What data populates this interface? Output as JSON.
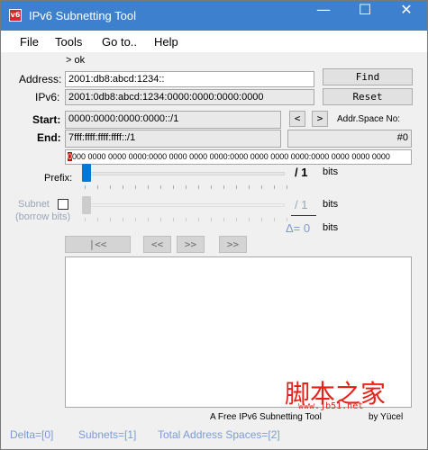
{
  "window": {
    "title": "IPv6 Subnetting Tool",
    "icon_text": "v6",
    "minimize_glyph": "—",
    "maximize_glyph": "☐",
    "close_glyph": "✕",
    "titlebar_color": "#3d80cd"
  },
  "menu": {
    "items": [
      "File",
      "Tools",
      "Go to..",
      "Help"
    ]
  },
  "status_line": "> ok",
  "address": {
    "label": "Address:",
    "value": "2001:db8:abcd:1234::"
  },
  "ipv6": {
    "label": "IPv6:",
    "value": "2001:0db8:abcd:1234:0000:0000:0000:0000"
  },
  "buttons": {
    "find": "Find",
    "reset": "Reset",
    "prev": "<",
    "next": ">"
  },
  "addr_space_no": {
    "label": "Addr.Space No:",
    "value": "#0"
  },
  "start": {
    "label": "Start:",
    "value": "0000:0000:0000:0000::/1"
  },
  "end": {
    "label": "End:",
    "value": "7fff:ffff:ffff:ffff::/1"
  },
  "bits_mask": {
    "first": "0",
    "rest": "000 0000 0000 0000:0000 0000 0000 0000:0000 0000 0000 0000:0000 0000 0000 0000",
    "highlight_color": "#cc0000"
  },
  "prefix": {
    "label": "Prefix:",
    "value_text": "/ 1",
    "unit": "bits"
  },
  "subnet": {
    "label": "Subnet",
    "sublabel": "(borrow bits)",
    "value_text": "/ 1",
    "unit": "bits"
  },
  "delta": {
    "text": "Δ= 0",
    "unit": "bits"
  },
  "nav_buttons": {
    "first": "|<<",
    "back": "<<",
    "forward": ">>",
    "last": ">>"
  },
  "footer": {
    "credit": "A Free IPv6 Subnetting Tool",
    "author": "by Yücel"
  },
  "watermark": {
    "text": "脚本之家",
    "url": "www.jb51.net"
  },
  "statusbar": {
    "delta": "Delta=[0]",
    "subnets": "Subnets=[1]",
    "spaces": "Total Address Spaces=[2]"
  }
}
